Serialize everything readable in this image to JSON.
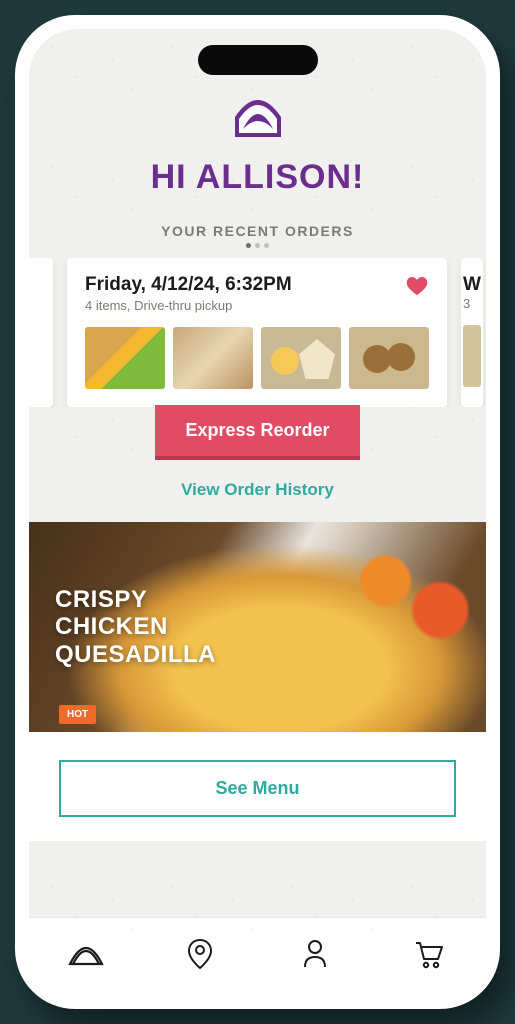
{
  "greeting": "HI ALLISON!",
  "section_label": "YOUR RECENT ORDERS",
  "order_card": {
    "title": "Friday, 4/12/24, 6:32PM",
    "subtitle": "4 items, Drive-thru pickup",
    "favorited": true
  },
  "peek_right": {
    "title_fragment": "W",
    "sub_fragment": "3"
  },
  "express_btn": "Express Reorder",
  "history_link": "View Order History",
  "promo_text": "CRISPY\nCHICKEN\nQUESADILLA",
  "menu_btn": "See Menu",
  "colors": {
    "brand_purple": "#6b2e8f",
    "accent_red": "#e24b64",
    "accent_teal": "#2faaa0"
  },
  "tabs": [
    "home",
    "locations",
    "account",
    "cart"
  ]
}
